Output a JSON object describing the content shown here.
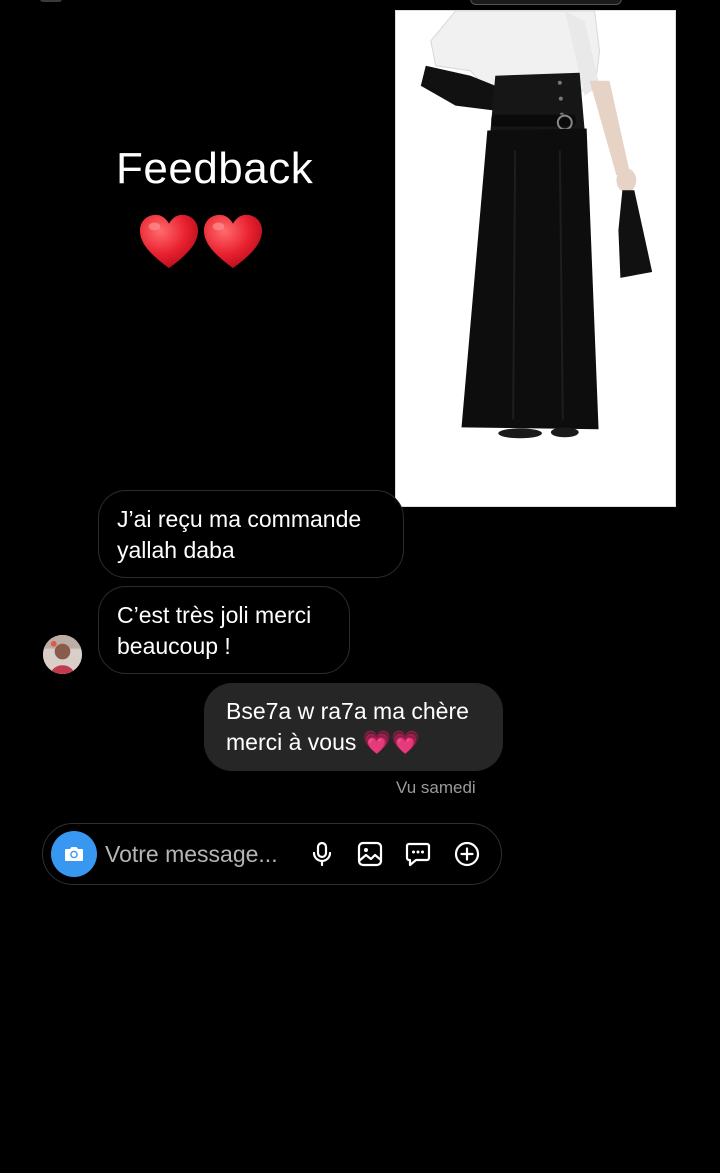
{
  "story": {
    "title": "Feedback",
    "hearts_icon": "red-heart-icon",
    "heart_color": "#e8202f"
  },
  "messages": [
    {
      "from": "customer",
      "text": "J’ai reçu ma commande\nyallah daba"
    },
    {
      "from": "customer",
      "text": "C’est très joli merci\nbeaucoup !"
    },
    {
      "from": "shop",
      "text": "Bse7a w ra7a ma chère\nmerci à vous 💗💗"
    }
  ],
  "status": {
    "seen": "Vu samedi"
  },
  "composer": {
    "placeholder": "Votre message...",
    "camera_icon": "camera-icon",
    "accent_color": "#3897f0",
    "icons": [
      "microphone-icon",
      "gallery-icon",
      "sticker-icon",
      "plus-icon"
    ]
  },
  "colors": {
    "background": "#000000",
    "sent_bubble": "#262626",
    "received_border": "#2c2c2c"
  }
}
